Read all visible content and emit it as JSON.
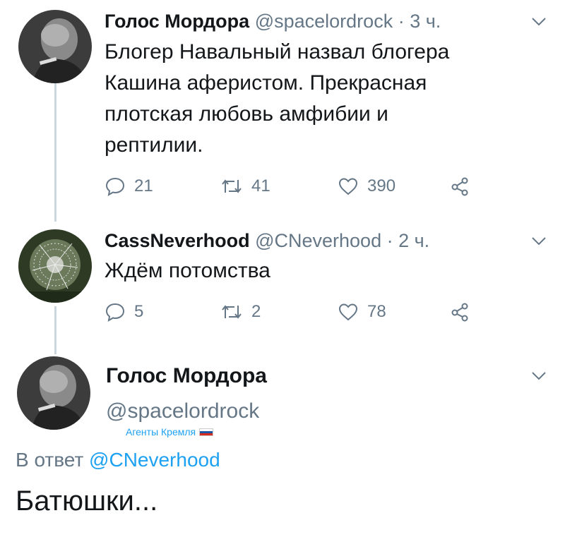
{
  "tweets": [
    {
      "name": "Голос Мордора",
      "handle": "@spacelordrock",
      "time": "· 3 ч.",
      "text_lines": [
        "Блогер Навальный назвал блогера",
        "Кашина аферистом. Прекрасная",
        "плотская любовь амфибии и",
        "рептилии."
      ],
      "replies": "21",
      "retweets": "41",
      "likes": "390"
    },
    {
      "name": "CassNeverhood",
      "handle": "@CNeverhood",
      "time": "· 2 ч.",
      "text_lines": [
        "Ждём потомства"
      ],
      "replies": "5",
      "retweets": "2",
      "likes": "78"
    }
  ],
  "main_tweet": {
    "name": "Голос Мордора",
    "handle": "@spacelordrock",
    "badge": "Агенты Кремля",
    "reply_prefix": "В ответ",
    "reply_mention": "@CNeverhood",
    "text": "Батюшки..."
  },
  "colors": {
    "text": "#14171a",
    "secondary": "#657786",
    "link": "#1da1f2",
    "thread_line": "#ccd6dd"
  }
}
